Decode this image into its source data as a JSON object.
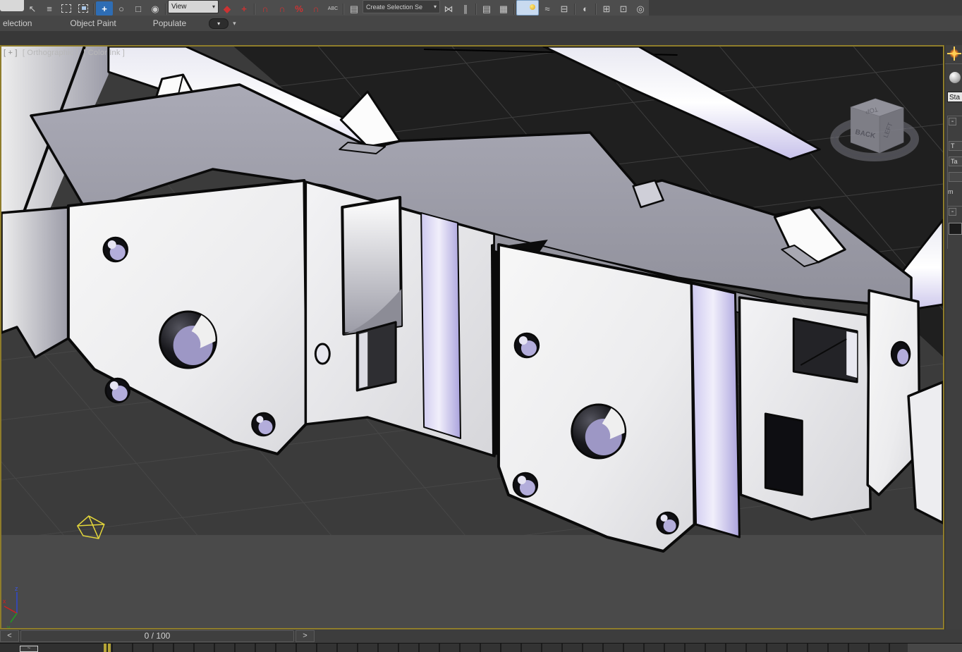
{
  "toolbar": {
    "items": [
      {
        "name": "flyout-partial",
        "glyph": ""
      },
      {
        "name": "select-object",
        "glyph": "↖"
      },
      {
        "name": "select-by-name",
        "glyph": "≡"
      },
      {
        "name": "rect-selection-region",
        "glyph": ""
      },
      {
        "name": "window-crossing",
        "glyph": ""
      },
      {
        "name": "select-and-move",
        "glyph": "+"
      },
      {
        "name": "select-and-rotate",
        "glyph": "○"
      },
      {
        "name": "select-and-scale",
        "glyph": "□"
      },
      {
        "name": "select-and-manipulate",
        "glyph": "◉"
      },
      {
        "name": "reference-coordinate-system",
        "label": "View",
        "caret": "▾"
      },
      {
        "name": "use-pivot-point-center",
        "glyph": "◆"
      },
      {
        "name": "select-and-place",
        "glyph": "+"
      },
      {
        "name": "snap-toggle-3d",
        "glyph": "∩"
      },
      {
        "name": "angle-snap",
        "glyph": "∩"
      },
      {
        "name": "percent-snap",
        "glyph": "%"
      },
      {
        "name": "spinner-snap",
        "glyph": "∩"
      },
      {
        "name": "keyboard-override",
        "glyph": "ABC"
      },
      {
        "name": "edit-named-selection-sets",
        "glyph": "▤"
      },
      {
        "name": "named-selection-combo",
        "label": "Create Selection Se",
        "caret": "▾"
      },
      {
        "name": "mirror",
        "glyph": "⋈"
      },
      {
        "name": "align",
        "glyph": "∥"
      },
      {
        "name": "layer-manager",
        "glyph": "▤"
      },
      {
        "name": "scene-explorer",
        "glyph": "▦"
      },
      {
        "name": "ribbon-toggle",
        "glyph": ""
      },
      {
        "name": "curve-editor",
        "glyph": "≈"
      },
      {
        "name": "schematic-view",
        "glyph": "⊟"
      },
      {
        "name": "material-editor",
        "glyph": "◐"
      },
      {
        "name": "render-setup",
        "glyph": "⊞"
      },
      {
        "name": "rendered-frame-window",
        "glyph": "⊡"
      },
      {
        "name": "render-production",
        "glyph": "◎"
      }
    ]
  },
  "ribbon": {
    "tabs": [
      {
        "label": "election"
      },
      {
        "label": "Object Paint"
      },
      {
        "label": "Populate"
      }
    ],
    "pill_caret": "▾",
    "caret": "▾"
  },
  "viewport": {
    "label_menu": "[ + ]",
    "label_pov": "[ Orthographic ]",
    "label_shading": "[ Color Ink ]",
    "border_color": "#8f7d2b"
  },
  "viewcube": {
    "top": "TOP",
    "back": "BACK",
    "left": "LEFT"
  },
  "axis_gizmo": {
    "x": "x",
    "y": "y",
    "z": "z"
  },
  "right_panel": {
    "material_type": "Sta",
    "rollout1_collapse": "-",
    "rollout2_collapse": "-",
    "field1": "T",
    "field2": "Ta",
    "field3": "",
    "label_m": "m"
  },
  "timeline": {
    "prev": "<",
    "frame_display": "0 / 100",
    "next": ">"
  },
  "trackbar": {
    "curve_glyph": "~"
  },
  "colors": {
    "active_tool_blue": "#2e6db4",
    "snap_red": "#cc3333",
    "viewport_border_yellow": "#8f7d2b",
    "helper_yellow": "#e3d63b",
    "ink_outline": "#0a0a0a",
    "toon_lavender": "#b9b3e0",
    "dark_ground": "#1f1f1f"
  }
}
